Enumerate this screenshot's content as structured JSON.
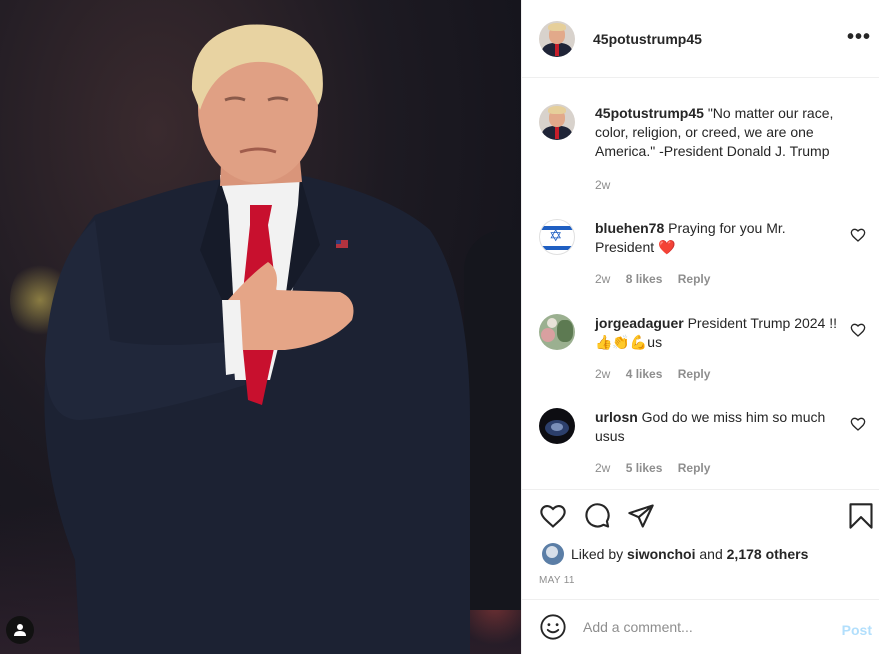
{
  "post": {
    "author": "45potustrump45",
    "caption_user": "45potustrump45",
    "caption_text": "\"No matter our race, color, religion, or creed, we are one America.\" -President Donald J. Trump",
    "caption_time": "2w",
    "more_icon": "more-horizontal-icon"
  },
  "comments": [
    {
      "user": "bluehen78",
      "text": "Praying for you Mr. President",
      "emoji": "❤️",
      "time": "2w",
      "likes": "8 likes",
      "reply": "Reply"
    },
    {
      "user": "jorgeadaguer",
      "text": "President Trump 2024 !! 👍👏💪us",
      "time": "2w",
      "likes": "4 likes",
      "reply": "Reply"
    },
    {
      "user": "urlosn",
      "text": "God do we miss him so much usus",
      "time": "2w",
      "likes": "5 likes",
      "reply": "Reply"
    }
  ],
  "actions": {
    "like_icon": "heart-icon",
    "comment_icon": "comment-icon",
    "share_icon": "share-icon",
    "save_icon": "bookmark-icon",
    "liked_by_prefix": "Liked by",
    "liked_by_user": "siwonchoi",
    "liked_by_and": "and",
    "liked_by_count": "2,178 others",
    "date": "MAY 11"
  },
  "add_comment": {
    "placeholder": "Add a comment...",
    "post_label": "Post",
    "emoji_icon": "smiley-icon"
  },
  "colors": {
    "link_disabled": "#b2dffc",
    "muted": "#8e8e8e",
    "heart_red": "#ed4956"
  }
}
